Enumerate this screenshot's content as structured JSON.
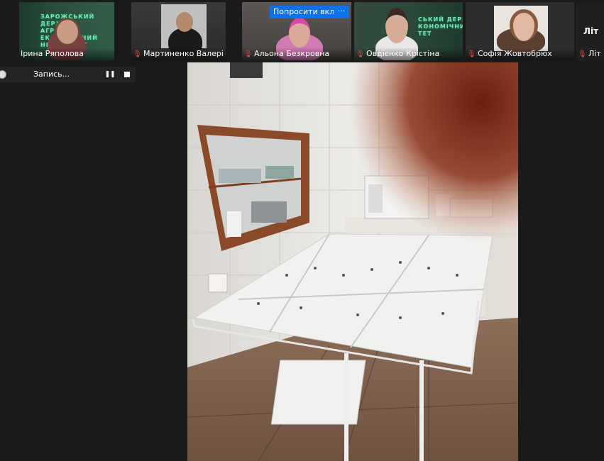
{
  "participants": [
    {
      "name": "Ірина Ряполова",
      "muted": false
    },
    {
      "name": "Мартиненко Валерія",
      "muted": true
    },
    {
      "name": "Альона Безкровна",
      "muted": true
    },
    {
      "name": "Овдієнко Крістіна",
      "muted": true
    },
    {
      "name": "Софія Жовтобрюх",
      "muted": true
    },
    {
      "name": "Літ",
      "muted": true
    }
  ],
  "overflow_tile_label": "Літ",
  "ask_button_label": "Попросити вкл",
  "more_button_label": "···",
  "recording": {
    "label": "Запись...",
    "pause_glyph": "❚❚"
  },
  "colors": {
    "ask_button": "#0e71eb",
    "mic_muted": "#e5484d",
    "background": "#1a1a1a"
  }
}
